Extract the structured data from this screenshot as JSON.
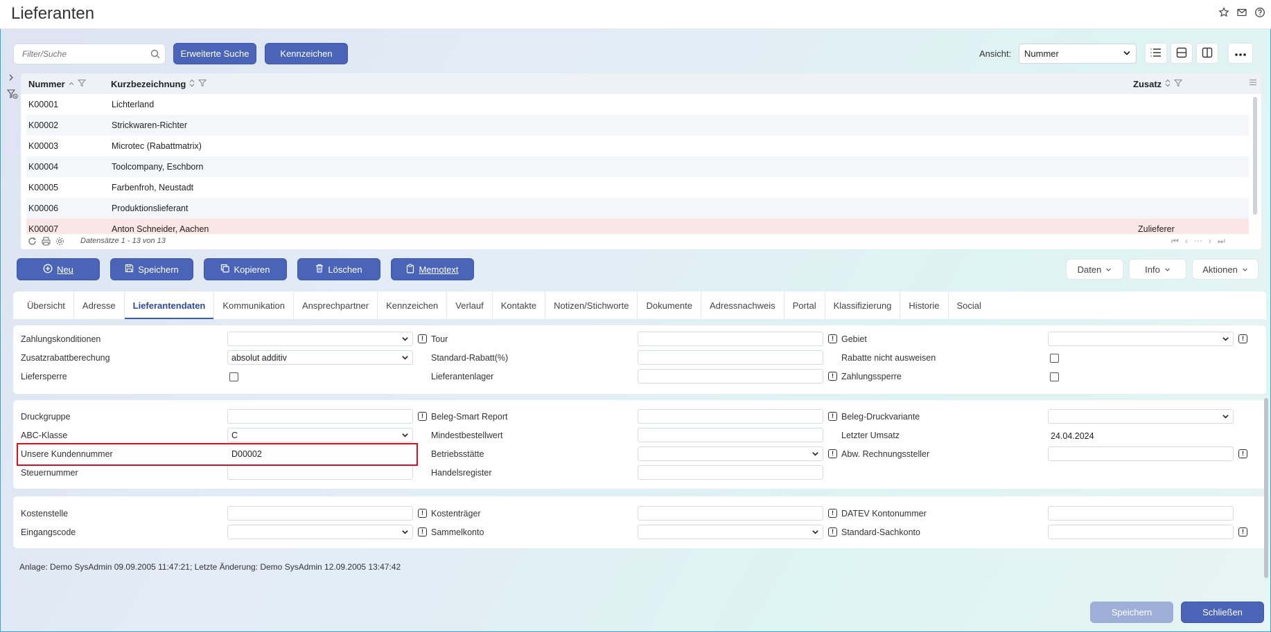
{
  "header": {
    "title": "Lieferanten"
  },
  "toolbar": {
    "search_placeholder": "Filter/Suche",
    "extended_search": "Erweiterte Suche",
    "flags": "Kennzeichen",
    "view_label": "Ansicht:",
    "view_value": "Nummer"
  },
  "grid": {
    "columns": {
      "number": "Nummer",
      "short": "Kurzbezeichnung",
      "extra": "Zusatz"
    },
    "rows": [
      {
        "number": "K00001",
        "short": "Lichterland",
        "extra": ""
      },
      {
        "number": "K00002",
        "short": "Strickwaren-Richter",
        "extra": ""
      },
      {
        "number": "K00003",
        "short": "Microtec (Rabattmatrix)",
        "extra": ""
      },
      {
        "number": "K00004",
        "short": "Toolcompany, Eschborn",
        "extra": ""
      },
      {
        "number": "K00005",
        "short": "Farbenfroh, Neustadt",
        "extra": ""
      },
      {
        "number": "K00006",
        "short": "Produktionslieferant",
        "extra": ""
      },
      {
        "number": "K00007",
        "short": "Anton Schneider, Aachen",
        "extra": "Zulieferer"
      }
    ],
    "record_info": "Datensätze 1 - 13 von 13"
  },
  "actions": {
    "new": "Neu",
    "save": "Speichern",
    "copy": "Kopieren",
    "delete": "Löschen",
    "memo": "Memotext",
    "data": "Daten",
    "info": "Info",
    "actions": "Aktionen"
  },
  "tabs": [
    "Übersicht",
    "Adresse",
    "Lieferantendaten",
    "Kommunikation",
    "Ansprechpartner",
    "Kennzeichen",
    "Verlauf",
    "Kontakte",
    "Notizen/Stichworte",
    "Dokumente",
    "Adressnachweis",
    "Portal",
    "Klassifizierung",
    "Historie",
    "Social"
  ],
  "form": {
    "zahlungskonditionen": "Zahlungskonditionen",
    "tour": "Tour",
    "gebiet": "Gebiet",
    "zusatzrabatt": "Zusatzrabattberechung",
    "zusatzrabatt_value": "absolut additiv",
    "standard_rabatt": "Standard-Rabatt(%)",
    "rabatte_nicht": "Rabatte nicht ausweisen",
    "liefersperre": "Liefersperre",
    "lieferantenlager": "Lieferantenlager",
    "zahlungssperre": "Zahlungssperre",
    "druckgruppe": "Druckgruppe",
    "beleg_smart": "Beleg-Smart Report",
    "beleg_druck": "Beleg-Druckvariante",
    "abc": "ABC-Klasse",
    "abc_value": "C",
    "mindestbestell": "Mindestbestellwert",
    "letzter_umsatz": "Letzter Umsatz",
    "letzter_umsatz_value": "24.04.2024",
    "kundennummer": "Unsere Kundennummer",
    "kundennummer_value": "D00002",
    "betriebsstaette": "Betriebsstätte",
    "abw_rechnung": "Abw. Rechnungssteller",
    "steuernummer": "Steuernummer",
    "handelsregister": "Handelsregister",
    "kostenstelle": "Kostenstelle",
    "kostentraeger": "Kostenträger",
    "datev": "DATEV Kontonummer",
    "eingangscode": "Eingangscode",
    "sammelkonto": "Sammelkonto",
    "standard_sachkonto": "Standard-Sachkonto"
  },
  "footer": {
    "audit": "Anlage: Demo SysAdmin 09.09.2005 11:47:21; Letzte Änderung: Demo SysAdmin 12.09.2005 13:47:42",
    "save": "Speichern",
    "close": "Schließen"
  }
}
